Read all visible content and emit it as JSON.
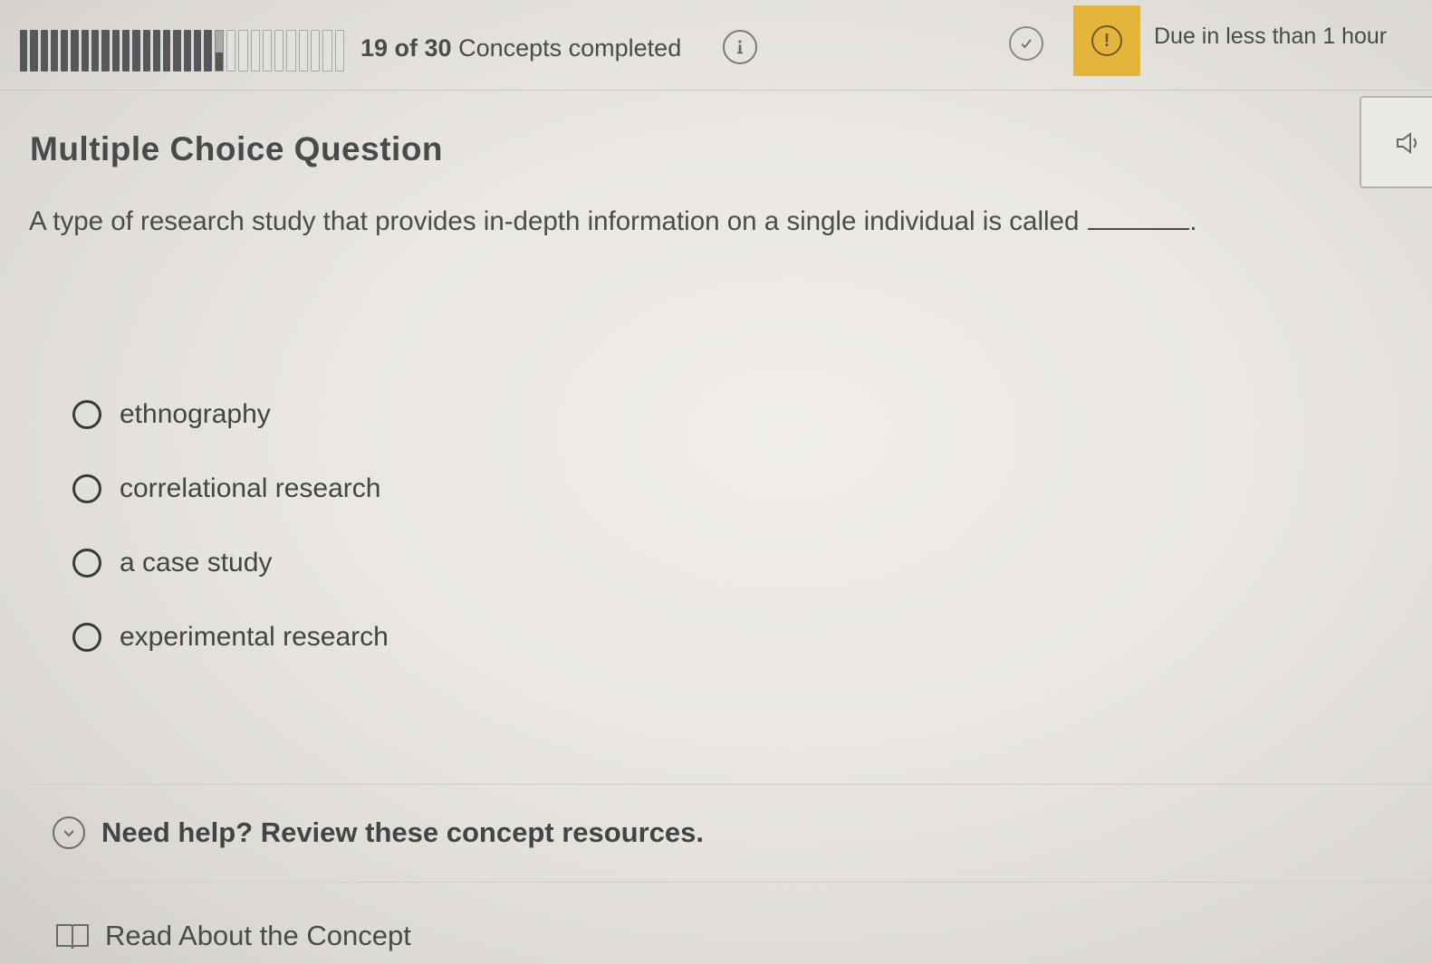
{
  "progress": {
    "completed": 19,
    "total": 30,
    "count_text": "19 of 30",
    "label": "Concepts completed"
  },
  "icons": {
    "info": "info-icon",
    "check": "check-circle-icon",
    "alert": "alert-icon",
    "audio": "speaker-icon",
    "expand": "chevron-down-icon",
    "book": "book-icon"
  },
  "due": {
    "text": "Due in less than 1 hour",
    "alert_symbol": "!",
    "color": "#e4b43b"
  },
  "question": {
    "heading": "Multiple Choice Question",
    "text": "A type of research study that provides in-depth information on a single individual is called",
    "trailing": "."
  },
  "options": [
    {
      "label": "ethnography"
    },
    {
      "label": "correlational research"
    },
    {
      "label": "a case study"
    },
    {
      "label": "experimental research"
    }
  ],
  "help": {
    "text": "Need help? Review these concept resources."
  },
  "resources": {
    "read_label": "Read About the Concept"
  }
}
